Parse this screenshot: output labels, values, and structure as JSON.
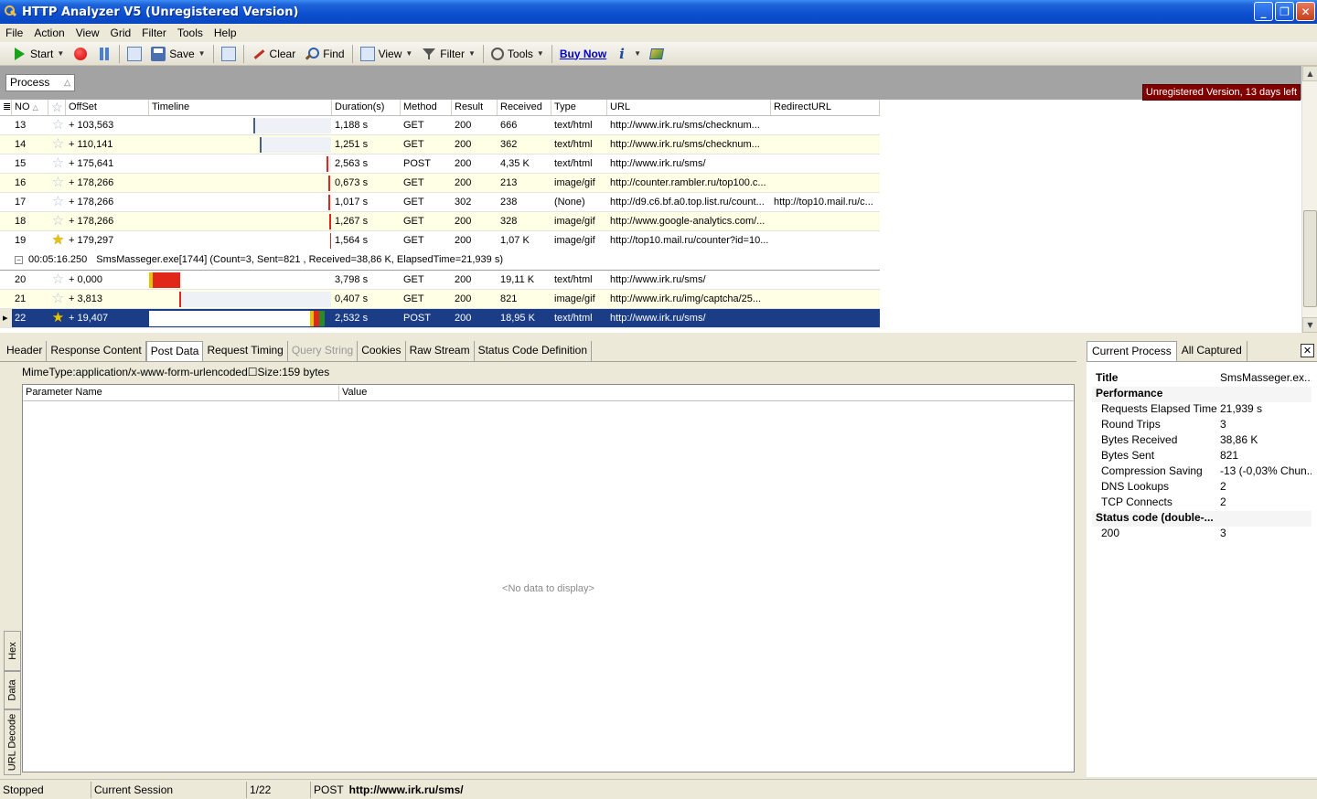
{
  "window": {
    "title": "HTTP Analyzer V5  (Unregistered Version)",
    "controls": [
      "_",
      "❐",
      "✕"
    ]
  },
  "menu": [
    "File",
    "Action",
    "View",
    "Grid",
    "Filter",
    "Tools",
    "Help"
  ],
  "toolbar": {
    "start": "Start",
    "save": "Save",
    "clear": "Clear",
    "find": "Find",
    "view": "View",
    "filter": "Filter",
    "tools": "Tools",
    "buy_now": "Buy Now"
  },
  "group_panel": {
    "process_chip": "Process",
    "unregistered_badge": "Unregistered Version, 13 days left"
  },
  "grid": {
    "columns": [
      "NO",
      "OffSet",
      "Timeline",
      "Duration(s)",
      "Method",
      "Result",
      "Received",
      "Type",
      "URL",
      "RedirectURL"
    ],
    "rows": [
      {
        "no": "13",
        "starred": false,
        "offset": "+ 103,563",
        "duration": "1,188 s",
        "method": "GET",
        "result": "200",
        "received": "666",
        "type": "text/html",
        "url": "http://www.irk.ru/sms/checknum...",
        "redirect": ""
      },
      {
        "no": "14",
        "starred": false,
        "offset": "+ 110,141",
        "duration": "1,251 s",
        "method": "GET",
        "result": "200",
        "received": "362",
        "type": "text/html",
        "url": "http://www.irk.ru/sms/checknum...",
        "redirect": ""
      },
      {
        "no": "15",
        "starred": false,
        "offset": "+ 175,641",
        "duration": "2,563 s",
        "method": "POST",
        "result": "200",
        "received": "4,35 K",
        "type": "text/html",
        "url": "http://www.irk.ru/sms/",
        "redirect": ""
      },
      {
        "no": "16",
        "starred": false,
        "offset": "+ 178,266",
        "duration": "0,673 s",
        "method": "GET",
        "result": "200",
        "received": "213",
        "type": "image/gif",
        "url": "http://counter.rambler.ru/top100.c...",
        "redirect": ""
      },
      {
        "no": "17",
        "starred": false,
        "offset": "+ 178,266",
        "duration": "1,017 s",
        "method": "GET",
        "result": "302",
        "received": "238",
        "type": "(None)",
        "url": "http://d9.c6.bf.a0.top.list.ru/count...",
        "redirect": "http://top10.mail.ru/c..."
      },
      {
        "no": "18",
        "starred": false,
        "offset": "+ 178,266",
        "duration": "1,267 s",
        "method": "GET",
        "result": "200",
        "received": "328",
        "type": "image/gif",
        "url": "http://www.google-analytics.com/...",
        "redirect": ""
      },
      {
        "no": "19",
        "starred": true,
        "offset": "+ 179,297",
        "duration": "1,564 s",
        "method": "GET",
        "result": "200",
        "received": "1,07 K",
        "type": "image/gif",
        "url": "http://top10.mail.ru/counter?id=10...",
        "redirect": ""
      }
    ],
    "group_row": {
      "time": "00:05:16.250",
      "text": "SmsMasseger.exe[1744]  (Count=3, Sent=821 , Received=38,86 K, ElapsedTime=21,939 s)"
    },
    "rows2": [
      {
        "no": "20",
        "starred": false,
        "offset": "+ 0,000",
        "duration": "3,798 s",
        "method": "GET",
        "result": "200",
        "received": "19,11 K",
        "type": "text/html",
        "url": "http://www.irk.ru/sms/",
        "redirect": ""
      },
      {
        "no": "21",
        "starred": false,
        "offset": "+ 3,813",
        "duration": "0,407 s",
        "method": "GET",
        "result": "200",
        "received": "821",
        "type": "image/gif",
        "url": "http://www.irk.ru/img/captcha/25...",
        "redirect": ""
      },
      {
        "no": "22",
        "starred": true,
        "offset": "+ 19,407",
        "duration": "2,532 s",
        "method": "POST",
        "result": "200",
        "received": "18,95 K",
        "type": "text/html",
        "url": "http://www.irk.ru/sms/",
        "redirect": ""
      }
    ]
  },
  "detail": {
    "tabs": [
      "Header",
      "Response Content",
      "Post Data",
      "Request Timing",
      "Query String",
      "Cookies",
      "Raw Stream",
      "Status Code Definition"
    ],
    "active_tab": "Post Data",
    "mime_line": "MimeType:application/x-www-form-urlencoded☐Size:159 bytes",
    "param_columns": [
      "Parameter Name",
      "Value"
    ],
    "no_data": "<No data to display>",
    "side_tabs": [
      "Hex",
      "Data",
      "URL Decode"
    ]
  },
  "right_panel": {
    "tabs": [
      "Current Process",
      "All Captured"
    ],
    "close": "✕",
    "props": [
      {
        "kind": "top",
        "key": "Title",
        "value": "SmsMasseger.ex..."
      },
      {
        "kind": "cat",
        "key": "Performance",
        "value": ""
      },
      {
        "kind": "sub",
        "key": "Requests Elapsed Time",
        "value": "21,939 s"
      },
      {
        "kind": "sub",
        "key": "Round Trips",
        "value": "3"
      },
      {
        "kind": "sub",
        "key": "Bytes Received",
        "value": "38,86 K"
      },
      {
        "kind": "sub",
        "key": "Bytes Sent",
        "value": "821"
      },
      {
        "kind": "sub",
        "key": "Compression Saving",
        "value": "-13  (-0,03% Chun..."
      },
      {
        "kind": "sub",
        "key": "DNS Lookups",
        "value": "2"
      },
      {
        "kind": "sub",
        "key": "TCP Connects",
        "value": "2"
      },
      {
        "kind": "cat",
        "key": "Status code (double-...",
        "value": ""
      },
      {
        "kind": "sub",
        "key": "200",
        "value": "3"
      }
    ]
  },
  "status": {
    "state": "Stopped",
    "session": "Current Session",
    "count": "1/22",
    "method": "POST",
    "url": "http://www.irk.ru/sms/"
  },
  "colors": {
    "selection": "#1a3d86",
    "alt_row": "#ffffe6",
    "badge": "#800000",
    "timeline_red": "#e0271a",
    "timeline_yellow": "#e8c400",
    "timeline_green": "#2a8a2a"
  }
}
